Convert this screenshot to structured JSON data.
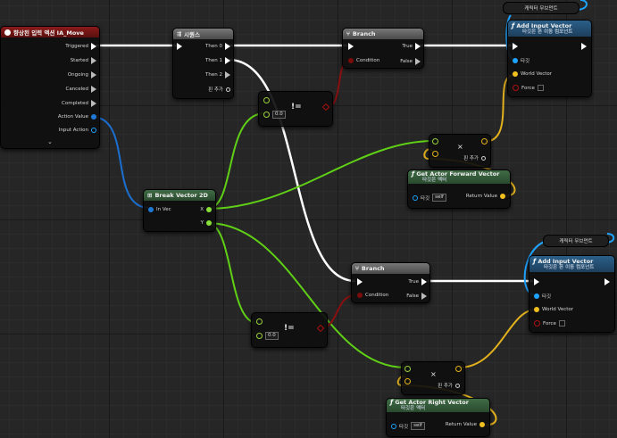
{
  "colors": {
    "grid_bg": "#262626",
    "event_header": "#8b1a1a",
    "exec_header": "#6a6a6a",
    "func_header_blue": "#2b5f88",
    "pure_header_green": "#3f6b45",
    "wire_green": "#5fd016",
    "wire_yellow": "#e2b11d",
    "wire_blue": "#1a6fd0",
    "wire_red": "#8a1010",
    "wire_exec": "#ffffff"
  },
  "event": {
    "title": "향상된 입력 액션 IA_Move",
    "pins": [
      "Triggered",
      "Started",
      "Ongoing",
      "Canceled",
      "Completed",
      "Action Value",
      "Input Action"
    ]
  },
  "sequence": {
    "title": "시퀀스",
    "then0": "Then 0",
    "then1": "Then 1",
    "then2": "Then 2",
    "add_pin": "핀 추가"
  },
  "branch1": {
    "title": "Branch",
    "condition": "Condition",
    "true": "True",
    "false": "False"
  },
  "branch2": {
    "title": "Branch",
    "condition": "Condition",
    "true": "True",
    "false": "False"
  },
  "notequal1": {
    "label": "!=",
    "value": "0.0"
  },
  "notequal2": {
    "label": "!=",
    "value": "0.0"
  },
  "break_vector": {
    "title": "Break Vector 2D",
    "invec": "In Vec",
    "x": "X",
    "y": "Y"
  },
  "multiply1": {
    "label": "×",
    "add_pin": "핀 추가"
  },
  "multiply2": {
    "label": "×",
    "add_pin": "핀 추가"
  },
  "forward": {
    "title": "Get Actor Forward Vector",
    "subtitle": "타깃은 액터",
    "target": "타깃",
    "self": "self",
    "ret": "Return Value"
  },
  "right": {
    "title": "Get Actor Right Vector",
    "subtitle": "타깃은 액터",
    "target": "타깃",
    "self": "self",
    "ret": "Return Value"
  },
  "comp_ref1": {
    "label": "캐릭터 무브먼트"
  },
  "comp_ref2": {
    "label": "캐릭터 무브먼트"
  },
  "add_input1": {
    "title": "Add Input Vector",
    "subtitle": "타깃은 폰 이동 컴포넌트",
    "target": "타깃",
    "world": "World Vector",
    "force": "Force"
  },
  "add_input2": {
    "title": "Add Input Vector",
    "subtitle": "타깃은 폰 이동 컴포넌트",
    "target": "타깃",
    "world": "World Vector",
    "force": "Force"
  }
}
